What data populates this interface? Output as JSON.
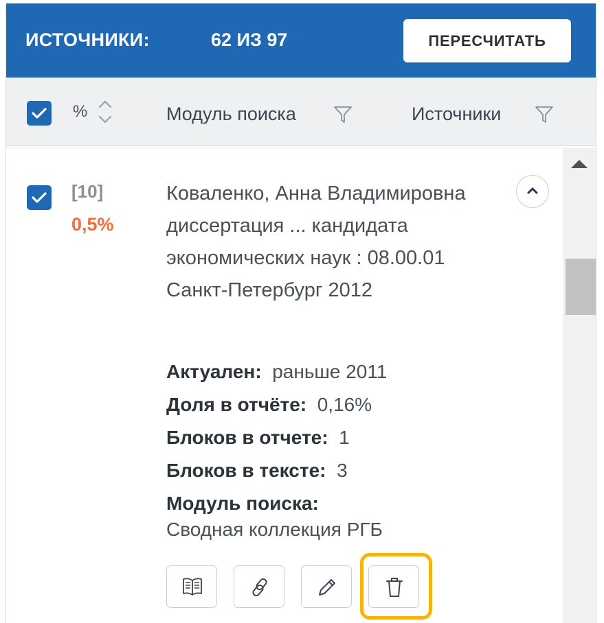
{
  "header": {
    "title": "ИСТОЧНИКИ:",
    "count": "62 ИЗ 97",
    "recalc_label": "ПЕРЕСЧИТАТЬ"
  },
  "columns": {
    "percent": "%",
    "module": "Модуль поиска",
    "sources": "Источники"
  },
  "item": {
    "number": "[10]",
    "percent": "0,5%",
    "title": "Коваленко, Анна Владимировна диссертация ... кандидата экономических наук : 08.00.01 Санкт-Петербург 2012",
    "details": [
      {
        "label": "Актуален:",
        "value": "раньше 2011"
      },
      {
        "label": "Доля в отчёте:",
        "value": "0,16%"
      },
      {
        "label": "Блоков в отчете:",
        "value": "1"
      },
      {
        "label": "Блоков в тексте:",
        "value": "3"
      },
      {
        "label": "Модуль поиска:",
        "value": ""
      }
    ],
    "module_value": "Сводная коллекция РГБ"
  },
  "icons": {
    "checkbox": "checkbox-checked-icon",
    "sort": "sort-icon",
    "filter": "filter-icon",
    "collapse": "chevron-up-icon",
    "book": "book-icon",
    "link": "link-icon",
    "edit": "pencil-icon",
    "delete": "trash-icon"
  },
  "colors": {
    "primary": "#1f69b4",
    "percent_accent": "#f46b3c",
    "highlight": "#f5b50b"
  }
}
